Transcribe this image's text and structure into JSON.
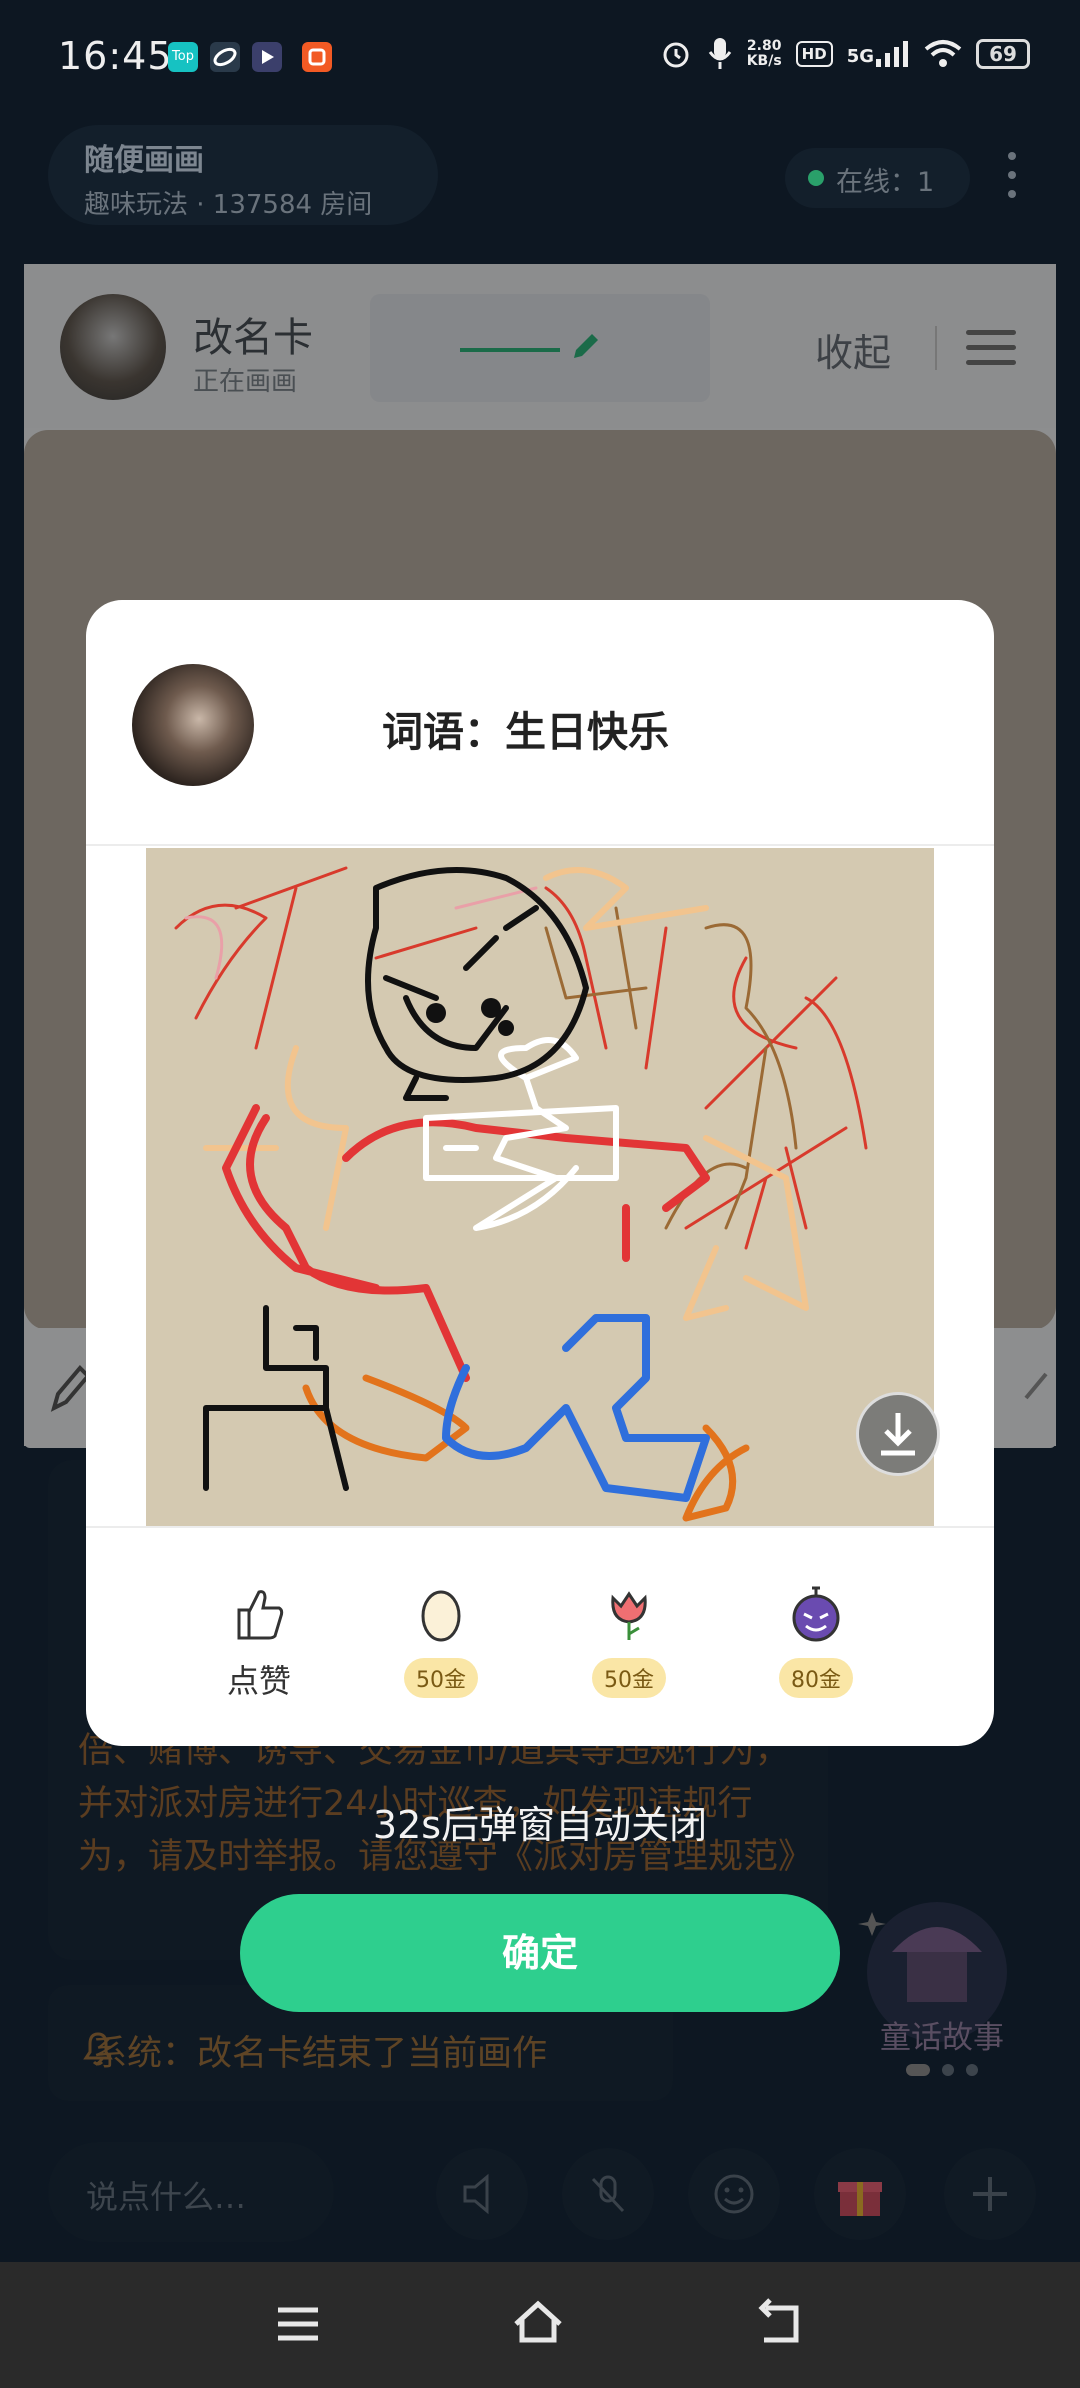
{
  "status_bar": {
    "time": "16:45",
    "network_speed": "2.80",
    "network_speed_unit": "KB/s",
    "hd_badge": "HD",
    "signal": "5G",
    "battery": "69",
    "app_icons": [
      {
        "label": "Top",
        "color": "#16c2c2"
      },
      {
        "label": "",
        "color": "#2a3a4a"
      },
      {
        "label": "",
        "color": "#3b3f6b"
      },
      {
        "label": "",
        "color": "#f25a24"
      }
    ]
  },
  "room": {
    "name": "随便画画",
    "meta": "趣味玩法 · 137584 房间",
    "online": "在线：1"
  },
  "drawer": {
    "name": "改名卡",
    "status": "正在画画",
    "collapse_label": "收起"
  },
  "chat": {
    "rules_text": "倍、赌博、诱导、交易金币/道具等违规行为，并对派对房进行24小时巡查，如发现违规行为，请及时举报。请您遵守《派对房管理规范》",
    "system_message": "系统：改名卡结束了当前画作",
    "promo_label": "童话故事",
    "input_placeholder": "说点什么…"
  },
  "modal": {
    "word_label": "词语：生日快乐",
    "gifts": [
      {
        "label": "点赞",
        "icon": "thumbs-up-icon"
      },
      {
        "label": "50金",
        "icon": "egg-icon"
      },
      {
        "label": "50金",
        "icon": "flower-icon"
      },
      {
        "label": "80金",
        "icon": "bomb-icon"
      }
    ],
    "countdown": "32s后弹窗自动关闭",
    "confirm_label": "确定"
  },
  "colors": {
    "accent_green": "#2ecf8e",
    "canvas_beige": "#d4c9b1",
    "price_badge": "#fae6a6"
  }
}
